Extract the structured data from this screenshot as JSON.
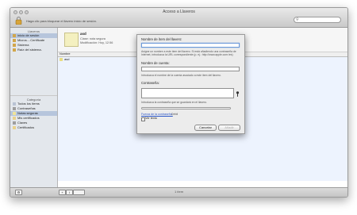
{
  "window": {
    "title": "Acceso a Llaveros",
    "lock_hint": "Haga clic para bloquear el llavero inicio de sesión.",
    "search_placeholder": ""
  },
  "sidebar": {
    "keychains_header": "Llaveros",
    "keychains": [
      {
        "label": "inicio de sesión",
        "icon": "keychain-icon",
        "selected": true
      },
      {
        "label": "Micros....Certificate",
        "icon": "keychain-icon",
        "selected": false
      },
      {
        "label": "Sistema",
        "icon": "keychain-icon",
        "selected": false
      },
      {
        "label": "Raíz del sistema.",
        "icon": "keychain-icon",
        "selected": false
      }
    ],
    "category_header": "Categoría",
    "categories": [
      {
        "label": "Todos los ítems",
        "icon": "items-icon",
        "selected": false
      },
      {
        "label": "Contraseñas",
        "icon": "key-icon",
        "selected": false
      },
      {
        "label": "Notas seguras",
        "icon": "note-icon",
        "selected": true
      },
      {
        "label": "Mis certificados",
        "icon": "certificate-icon",
        "selected": false
      },
      {
        "label": "Claves",
        "icon": "key-icon",
        "selected": false
      },
      {
        "label": "Certificados",
        "icon": "certificate-icon",
        "selected": false
      }
    ]
  },
  "info": {
    "name": "asd",
    "kind_label": "Clase:",
    "kind_value": "nota segura",
    "modified_label": "Modificación:",
    "modified_value": "Hoy, 12:56"
  },
  "table": {
    "column_name": "Nombre",
    "column_right": "",
    "rows": [
      {
        "name": "asd"
      }
    ]
  },
  "status_text": "1 ítem",
  "sheet": {
    "item_name_label": "Nombre de ítem del llavero:",
    "item_name_value": "",
    "item_name_hint": "Asigne un nombre a este ítem del llavero. Si está añadiendo una contraseña de Internet, introduzca la URL correspondiente (p. ej.: http://www.apple.com:/es)",
    "account_label": "Nombre de cuenta:",
    "account_value": "",
    "account_hint": "Introduzca el nombre de la cuenta asociado a este ítem del llavero.",
    "password_label": "Contraseña:",
    "password_value": "",
    "password_hint": "Introduzca la contraseña que se guardará en el llavero.",
    "strength_link": "Fuerza de la contraseña:",
    "strength_value": "Débil",
    "strength_fraction": 0,
    "show_text_label": "Ver texto",
    "cancel_label": "Cancelar",
    "add_label": "Añadir"
  }
}
